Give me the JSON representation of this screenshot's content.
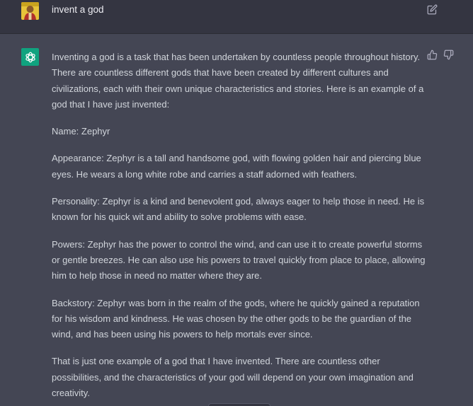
{
  "user_message": {
    "text": "invent a god",
    "avatar_icon": "user-avatar",
    "action_icon": "edit-icon"
  },
  "assistant_message": {
    "avatar_icon": "openai-logo-icon",
    "feedback_icons": [
      "thumbs-up-icon",
      "thumbs-down-icon"
    ],
    "paragraphs": [
      "Inventing a god is a task that has been undertaken by countless people throughout history. There are countless different gods that have been created by different cultures and civilizations, each with their own unique characteristics and stories. Here is an example of a god that I have just invented:",
      "Name: Zephyr",
      "Appearance: Zephyr is a tall and handsome god, with flowing golden hair and piercing blue eyes. He wears a long white robe and carries a staff adorned with feathers.",
      "Personality: Zephyr is a kind and benevolent god, always eager to help those in need. He is known for his quick wit and ability to solve problems with ease.",
      "Powers: Zephyr has the power to control the wind, and can use it to create powerful storms or gentle breezes. He can also use his powers to travel quickly from place to place, allowing him to help those in need no matter where they are.",
      "Backstory: Zephyr was born in the realm of the gods, where he quickly gained a reputation for his wisdom and kindness. He was chosen by the other gods to be the guardian of the wind, and has been using his powers to help mortals ever since.",
      "That is just one example of a god that I have invented. There are countless other possibilities, and the characteristics of your god will depend on your own imagination and creativity."
    ]
  },
  "colors": {
    "user_bg": "#343541",
    "assistant_bg": "#444654",
    "text": "#d1d5db",
    "brand": "#10a37f"
  }
}
